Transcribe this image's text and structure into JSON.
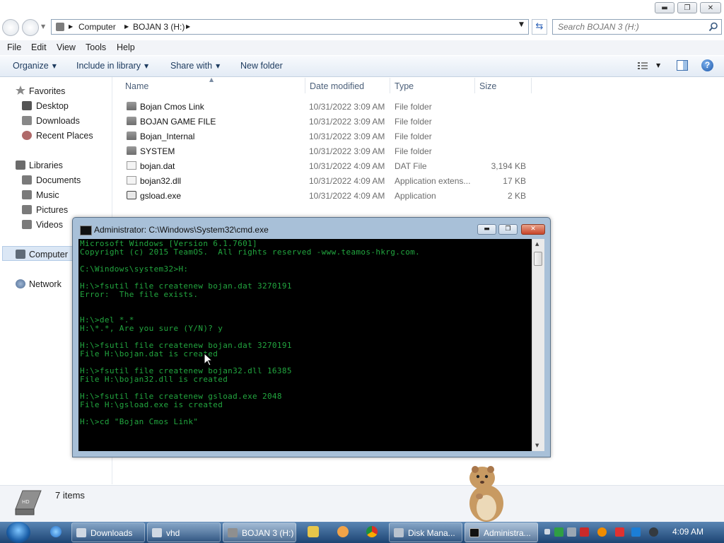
{
  "window": {
    "controls": {
      "minimize": "▬",
      "maximize": "❐",
      "close": "✕"
    }
  },
  "address": {
    "breadcrumbs": [
      "Computer",
      "BOJAN 3 (H:)"
    ],
    "search_placeholder": "Search BOJAN 3 (H:)"
  },
  "menu": [
    "File",
    "Edit",
    "View",
    "Tools",
    "Help"
  ],
  "toolbar": {
    "organize": "Organize",
    "include_in_library": "Include in library",
    "share_with": "Share with",
    "new_folder": "New folder"
  },
  "nav": {
    "favorites": "Favorites",
    "favorites_items": [
      "Desktop",
      "Downloads",
      "Recent Places"
    ],
    "libraries": "Libraries",
    "libraries_items": [
      "Documents",
      "Music",
      "Pictures",
      "Videos"
    ],
    "computer": "Computer",
    "network": "Network"
  },
  "columns": {
    "name": "Name",
    "date": "Date modified",
    "type": "Type",
    "size": "Size"
  },
  "files": [
    {
      "name": "Bojan Cmos Link",
      "date": "10/31/2022 3:09 AM",
      "type": "File folder",
      "size": "",
      "icon": "folder-icon"
    },
    {
      "name": "BOJAN GAME FILE",
      "date": "10/31/2022 3:09 AM",
      "type": "File folder",
      "size": "",
      "icon": "folder-icon"
    },
    {
      "name": "Bojan_Internal",
      "date": "10/31/2022 3:09 AM",
      "type": "File folder",
      "size": "",
      "icon": "folder-icon"
    },
    {
      "name": "SYSTEM",
      "date": "10/31/2022 3:09 AM",
      "type": "File folder",
      "size": "",
      "icon": "folder-icon"
    },
    {
      "name": "bojan.dat",
      "date": "10/31/2022 4:09 AM",
      "type": "DAT File",
      "size": "3,194 KB",
      "icon": "file-icon"
    },
    {
      "name": "bojan32.dll",
      "date": "10/31/2022 4:09 AM",
      "type": "Application extens...",
      "size": "17 KB",
      "icon": "file-icon"
    },
    {
      "name": "gsload.exe",
      "date": "10/31/2022 4:09 AM",
      "type": "Application",
      "size": "2 KB",
      "icon": "app-icon"
    }
  ],
  "status": {
    "item_count": "7 items"
  },
  "cmd": {
    "title": "Administrator: C:\\Windows\\System32\\cmd.exe",
    "text": "Microsoft Windows [Version 6.1.7601]\nCopyright (c) 2015 TeamOS.  All rights reserved -www.teamos-hkrg.com.\n\nC:\\Windows\\system32>H:\n\nH:\\>fsutil file createnew bojan.dat 3270191\nError:  The file exists.\n\n\nH:\\>del *.*\nH:\\*.*, Are you sure (Y/N)? y\n\nH:\\>fsutil file createnew bojan.dat 3270191\nFile H:\\bojan.dat is created\n\nH:\\>fsutil file createnew bojan32.dll 16385\nFile H:\\bojan32.dll is created\n\nH:\\>fsutil file createnew gsload.exe 2048\nFile H:\\gsload.exe is created\n\nH:\\>cd \"Bojan Cmos Link\""
  },
  "taskbar": {
    "items": [
      "Downloads",
      "vhd",
      "BOJAN 3 (H:)",
      "Disk Mana...",
      "Administra..."
    ],
    "clock": "4:09 AM"
  },
  "colors": {
    "console_text": "#22a63f",
    "taskbar": "#1d4473",
    "selection": "#dbe7f5"
  }
}
